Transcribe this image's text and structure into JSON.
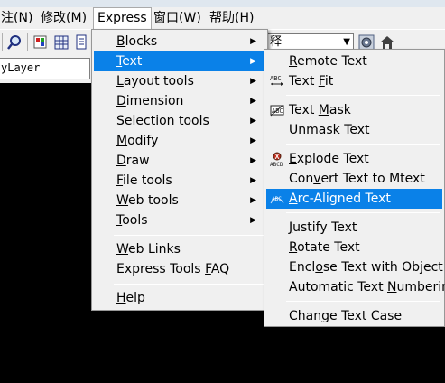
{
  "menubar": {
    "items": [
      {
        "pre": "注(",
        "u": "N",
        "post": ")"
      },
      {
        "pre": "修改(",
        "u": "M",
        "post": ")"
      },
      {
        "pre": "",
        "u": "E",
        "post": "xpress"
      },
      {
        "pre": "窗口(",
        "u": "W",
        "post": ")"
      },
      {
        "pre": "帮助(",
        "u": "H",
        "post": ")"
      }
    ]
  },
  "toolbar": {
    "combo_value": "释",
    "combo_arrow": "▼"
  },
  "layer": {
    "value": "yLayer"
  },
  "express_menu": {
    "items": [
      {
        "pre": "",
        "u": "B",
        "post": "locks",
        "submenu": true
      },
      {
        "pre": "",
        "u": "T",
        "post": "ext",
        "submenu": true
      },
      {
        "pre": "",
        "u": "L",
        "post": "ayout tools",
        "submenu": true
      },
      {
        "pre": "",
        "u": "D",
        "post": "imension",
        "submenu": true
      },
      {
        "pre": "",
        "u": "S",
        "post": "election tools",
        "submenu": true
      },
      {
        "pre": "",
        "u": "M",
        "post": "odify",
        "submenu": true
      },
      {
        "pre": "",
        "u": "D",
        "post": "raw",
        "submenu": true
      },
      {
        "pre": "",
        "u": "F",
        "post": "ile tools",
        "submenu": true
      },
      {
        "pre": "",
        "u": "W",
        "post": "eb tools",
        "submenu": true
      },
      {
        "pre": "",
        "u": "T",
        "post": "ools",
        "submenu": true
      },
      {
        "pre": "",
        "u": "W",
        "post": "eb Links",
        "submenu": false
      },
      {
        "pre": "Express Tools ",
        "u": "F",
        "post": "AQ",
        "submenu": false
      },
      {
        "pre": "",
        "u": "H",
        "post": "elp",
        "submenu": false
      }
    ]
  },
  "text_submenu": {
    "items": [
      {
        "pre": "",
        "u": "R",
        "post": "emote Text",
        "icon": ""
      },
      {
        "pre": "Text ",
        "u": "F",
        "post": "it",
        "icon": "text-fit-icon"
      },
      {
        "pre": "Text ",
        "u": "M",
        "post": "ask",
        "icon": "text-mask-icon"
      },
      {
        "pre": "",
        "u": "U",
        "post": "nmask Text",
        "icon": ""
      },
      {
        "pre": "",
        "u": "E",
        "post": "xplode Text",
        "icon": "explode-text-icon"
      },
      {
        "pre": "Con",
        "u": "v",
        "post": "ert Text to Mtext",
        "icon": ""
      },
      {
        "pre": "",
        "u": "A",
        "post": "rc-Aligned Text",
        "icon": "arc-aligned-text-icon"
      },
      {
        "pre": "",
        "u": "J",
        "post": "ustify Text",
        "icon": ""
      },
      {
        "pre": "",
        "u": "R",
        "post": "otate Text",
        "icon": ""
      },
      {
        "pre": "Encl",
        "u": "o",
        "post": "se Text with Object",
        "icon": ""
      },
      {
        "pre": "Automatic Text ",
        "u": "N",
        "post": "umbering",
        "icon": ""
      },
      {
        "pre": "Chan",
        "u": "g",
        "post": "e Text Case",
        "icon": ""
      }
    ]
  },
  "colors": {
    "highlight": "#0a81e8",
    "menu_bg": "#f0f0f0",
    "canvas": "#000000"
  }
}
